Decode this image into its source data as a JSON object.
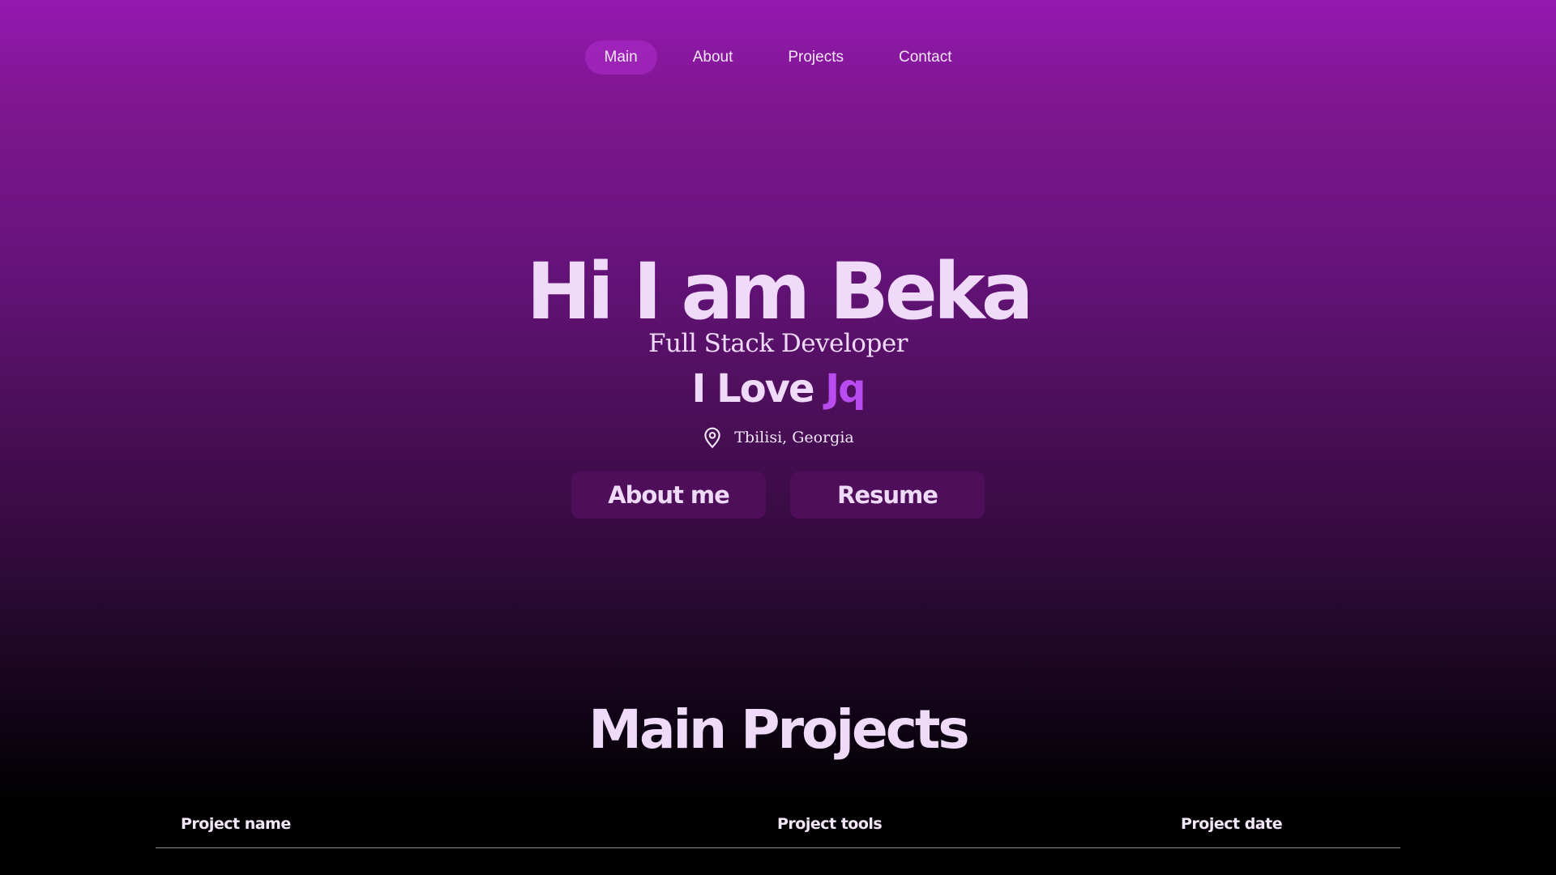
{
  "nav": {
    "items": [
      {
        "label": "Main",
        "active": true
      },
      {
        "label": "About",
        "active": false
      },
      {
        "label": "Projects",
        "active": false
      },
      {
        "label": "Contact",
        "active": false
      }
    ]
  },
  "hero": {
    "title": "Hi I am Beka",
    "subtitle": "Full Stack Developer",
    "love_prefix": "I Love",
    "love_highlight": "Jq",
    "location": "Tbilisi, Georgia",
    "location_icon": "map-pin-icon",
    "buttons": {
      "about": "About me",
      "resume": "Resume"
    }
  },
  "projects": {
    "title": "Main Projects",
    "columns": [
      "Project name",
      "Project tools",
      "Project date"
    ]
  },
  "colors": {
    "text": "#efdaf9",
    "accent": "#b94cf0",
    "button_bg": "#4e0e5a",
    "nav_active_bg": "#af2dcd"
  }
}
